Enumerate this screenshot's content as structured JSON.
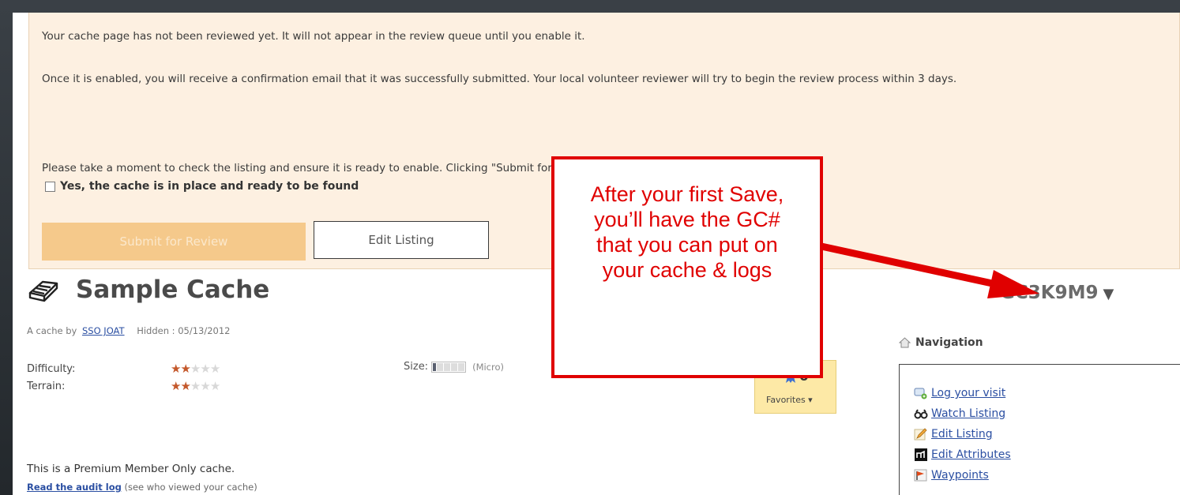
{
  "notice": {
    "line1": "Your cache page has not been reviewed yet. It will not appear in the review queue until you enable it.",
    "line2": "Once it is enabled, you will receive a confirmation email that it was successfully submitted. Your local volunteer reviewer will try to begin the review process within 3 days.",
    "line3": "Please take a moment to check the listing and ensure it is ready to enable. Clicking \"Submit for Review\" will enable your cache page.",
    "confirm_label": "Yes, the cache is in place and ready to be found",
    "confirm_checked": false,
    "submit_label": "Submit for Review",
    "edit_label": "Edit Listing"
  },
  "cache": {
    "title": "Sample Cache",
    "by_prefix": "A cache by",
    "owner": "SSO JOAT",
    "hidden": "Hidden : 05/13/2012",
    "gc_code": "GC3K9M9",
    "gc_arrow": "▼",
    "difficulty_label": "Difficulty:",
    "difficulty": 2,
    "terrain_label": "Terrain:",
    "terrain": 2,
    "size_label": "Size:",
    "size_text": "(Micro)",
    "favorites_count": "0",
    "favorites_label": "Favorites ▾",
    "premium_text": "This is a Premium Member Only cache.",
    "audit_link": "Read the audit log",
    "audit_suffix": " (see who viewed your cache)"
  },
  "navigation": {
    "heading": "Navigation",
    "items": [
      {
        "label": "Log your visit",
        "icon": "log-visit-icon"
      },
      {
        "label": "Watch Listing",
        "icon": "binoculars-icon"
      },
      {
        "label": "Edit Listing",
        "icon": "pencil-icon"
      },
      {
        "label": "Edit Attributes",
        "icon": "attributes-icon"
      },
      {
        "label": "Waypoints",
        "icon": "flag-icon"
      }
    ]
  },
  "callout": {
    "line1": "After your first Save,",
    "line2": "you’ll have the GC#",
    "line3": "that you can put on",
    "line4": "your cache & logs"
  },
  "colors": {
    "notice_bg": "#fdf0e1",
    "submit_bg": "#f5c98b",
    "callout_red": "#e00000",
    "link": "#2b4fa2",
    "star": "#c4582b",
    "favorites_bg": "#fde9a6"
  }
}
